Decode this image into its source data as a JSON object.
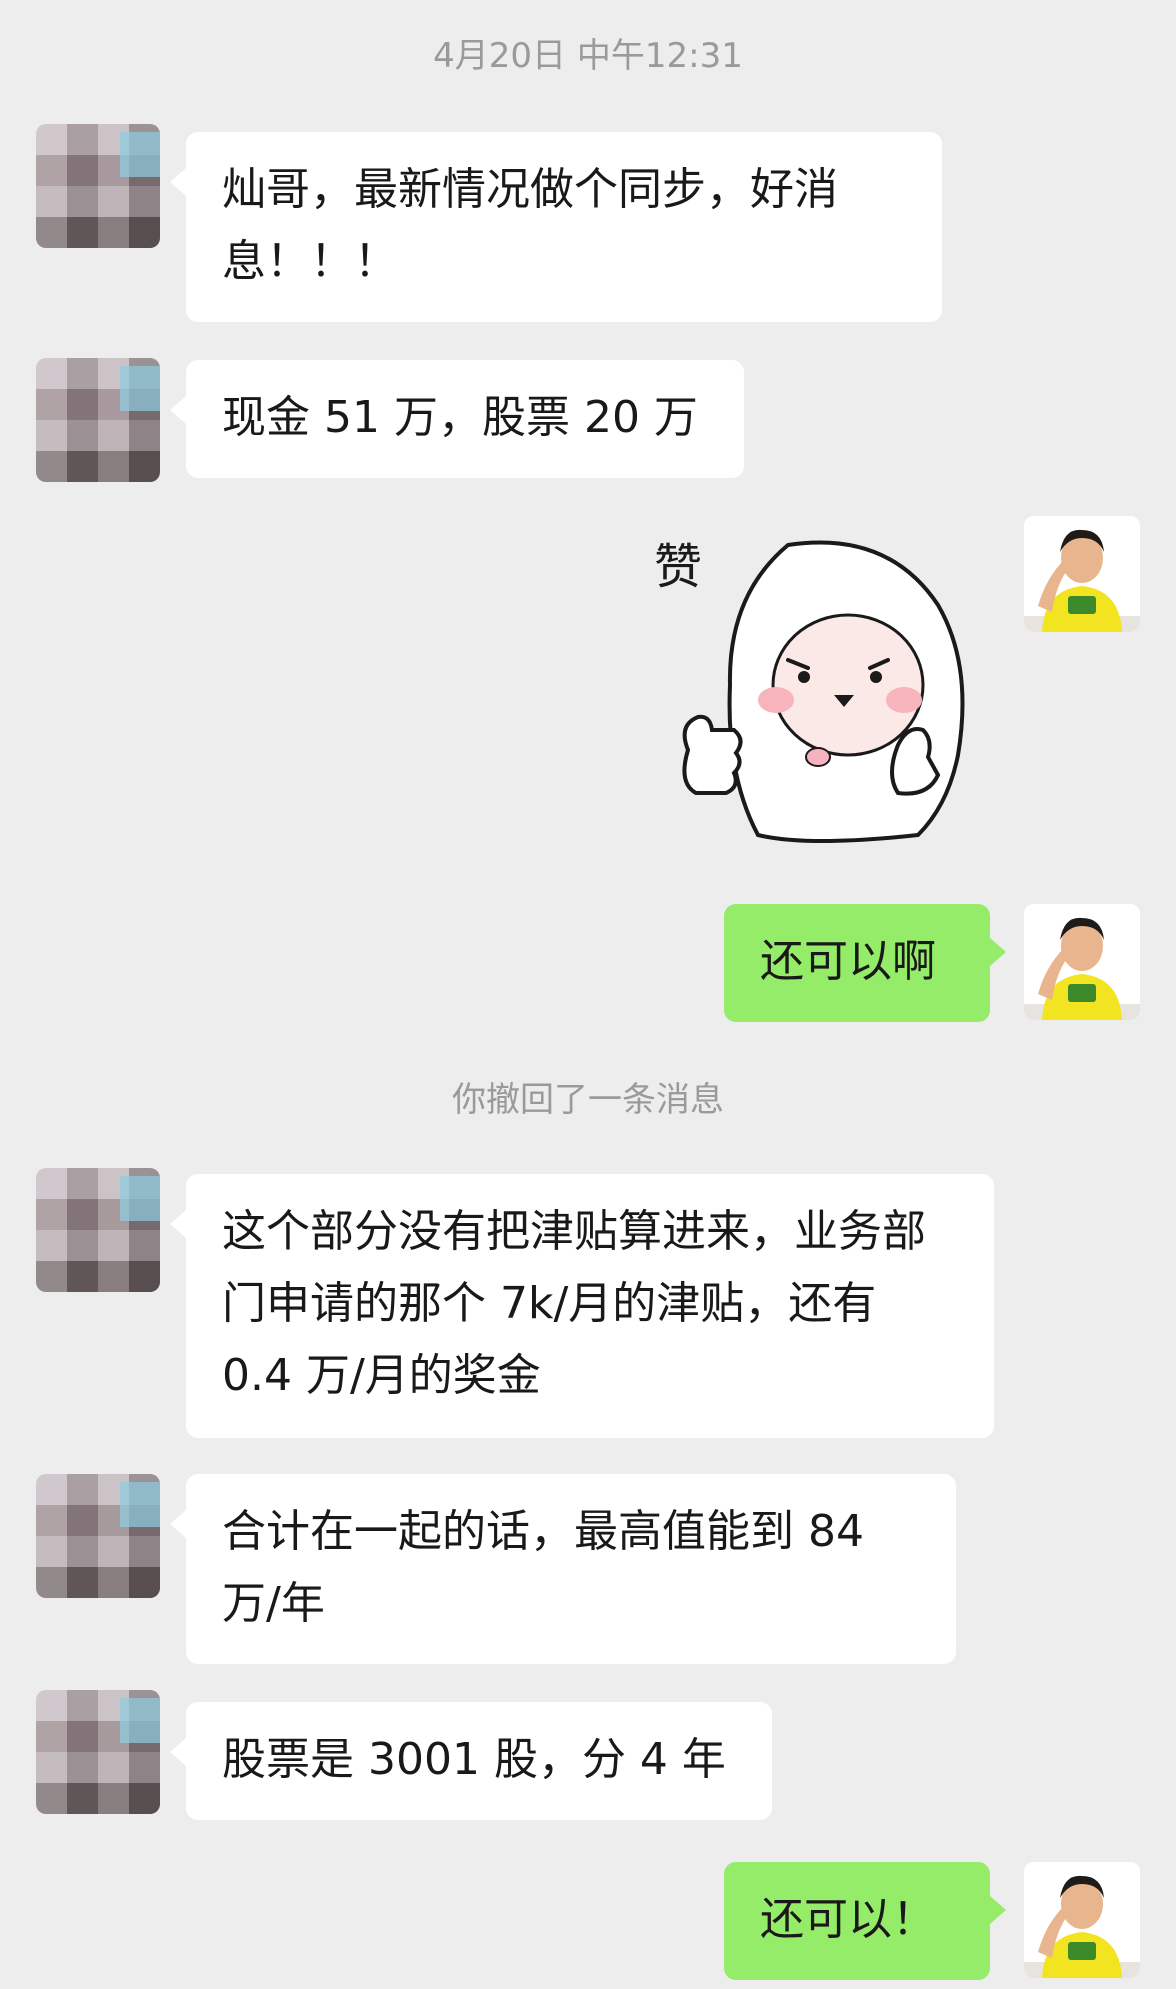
{
  "chat": {
    "timestamp": "4月20日 中午12:31",
    "recall_notice": "你撤回了一条消息",
    "messages": [
      {
        "side": "left",
        "text": "灿哥，最新情况做个同步，好消息！！！"
      },
      {
        "side": "left",
        "text": "现金 51 万，股票 20 万"
      },
      {
        "side": "right",
        "type": "sticker",
        "text": "赞",
        "icon": "thumbs-up-sticker"
      },
      {
        "side": "right",
        "text": "还可以啊"
      },
      {
        "side": "left",
        "text": "这个部分没有把津贴算进来，业务部门申请的那个 7k/月的津贴，还有 0.4 万/月的奖金"
      },
      {
        "side": "left",
        "text": "合计在一起的话，最高值能到 84 万/年"
      },
      {
        "side": "left",
        "text": "股票是 3001 股，分 4 年"
      },
      {
        "side": "right",
        "text": "还可以！"
      }
    ]
  },
  "colors": {
    "background": "#ededed",
    "bubble_left": "#ffffff",
    "bubble_right": "#95ec69",
    "system_text": "#9a9a9a",
    "shirt": "#f3e421"
  }
}
